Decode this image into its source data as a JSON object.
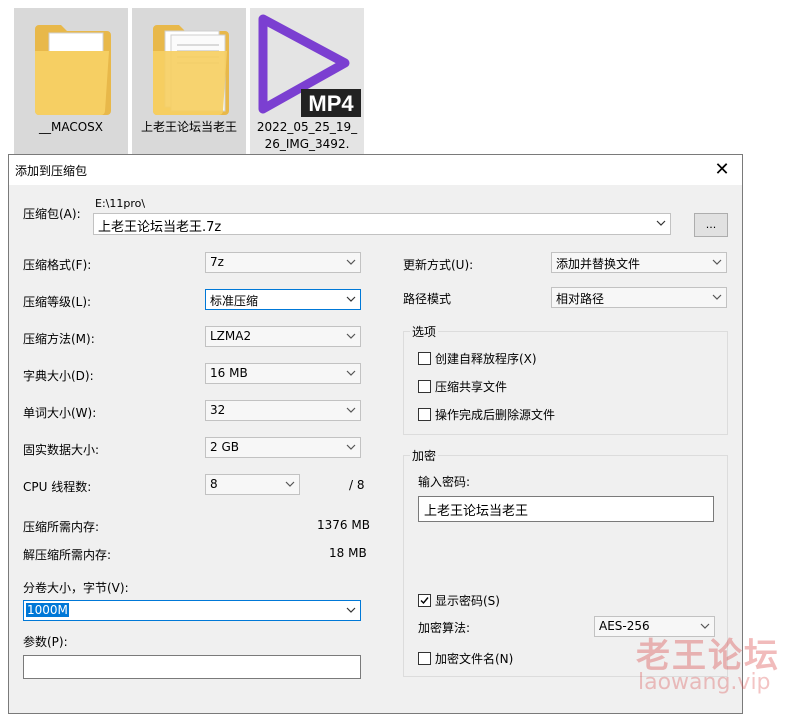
{
  "desktop": {
    "files": [
      {
        "name": "__MACOSX",
        "icon": "folder-icon"
      },
      {
        "name": "上老王论坛当老王",
        "icon": "folder-icon"
      },
      {
        "name": "2022_05_25_19_26_IMG_3492.",
        "icon": "mp4-file-icon",
        "badge": "MP4"
      }
    ]
  },
  "dialog": {
    "title": "添加到压缩包",
    "archive": {
      "label": "压缩包(A):",
      "path": "E:\\11pro\\",
      "value": "上老王论坛当老王.7z",
      "browse_label": "..."
    },
    "left": {
      "format": {
        "label": "压缩格式(F):",
        "value": "7z"
      },
      "level": {
        "label": "压缩等级(L):",
        "value": "标准压缩"
      },
      "method": {
        "label": "压缩方法(M):",
        "value": "LZMA2"
      },
      "dict": {
        "label": "字典大小(D):",
        "value": "16 MB"
      },
      "word": {
        "label": "单词大小(W):",
        "value": "32"
      },
      "solid": {
        "label": "固实数据大小:",
        "value": "2 GB"
      },
      "cpu": {
        "label": "CPU 线程数:",
        "value": "8",
        "max": "/ 8"
      },
      "mem_comp": {
        "label": "压缩所需内存:",
        "value": "1376 MB"
      },
      "mem_decomp": {
        "label": "解压缩所需内存:",
        "value": "18 MB"
      },
      "split": {
        "label": "分卷大小，字节(V):",
        "value": "1000M"
      },
      "params": {
        "label": "参数(P):",
        "value": ""
      }
    },
    "right": {
      "update": {
        "label": "更新方式(U):",
        "value": "添加并替换文件"
      },
      "pathmode": {
        "label": "路径模式",
        "value": "相对路径"
      },
      "options": {
        "title": "选项",
        "items": [
          {
            "label": "创建自释放程序(X)",
            "checked": false
          },
          {
            "label": "压缩共享文件",
            "checked": false
          },
          {
            "label": "操作完成后删除源文件",
            "checked": false
          }
        ]
      },
      "encryption": {
        "title": "加密",
        "password_label": "输入密码:",
        "password_value": "上老王论坛当老王",
        "show_password": {
          "label": "显示密码(S)",
          "checked": true
        },
        "method_label": "加密算法:",
        "method_value": "AES-256",
        "encrypt_names": {
          "label": "加密文件名(N)",
          "checked": false
        }
      }
    }
  },
  "watermark": {
    "line1": "老王论坛",
    "line2": "laowang.vip"
  },
  "colors": {
    "accent": "#0078d7",
    "dialog_bg": "#f0f0f0",
    "selection": "#cde4f7"
  }
}
